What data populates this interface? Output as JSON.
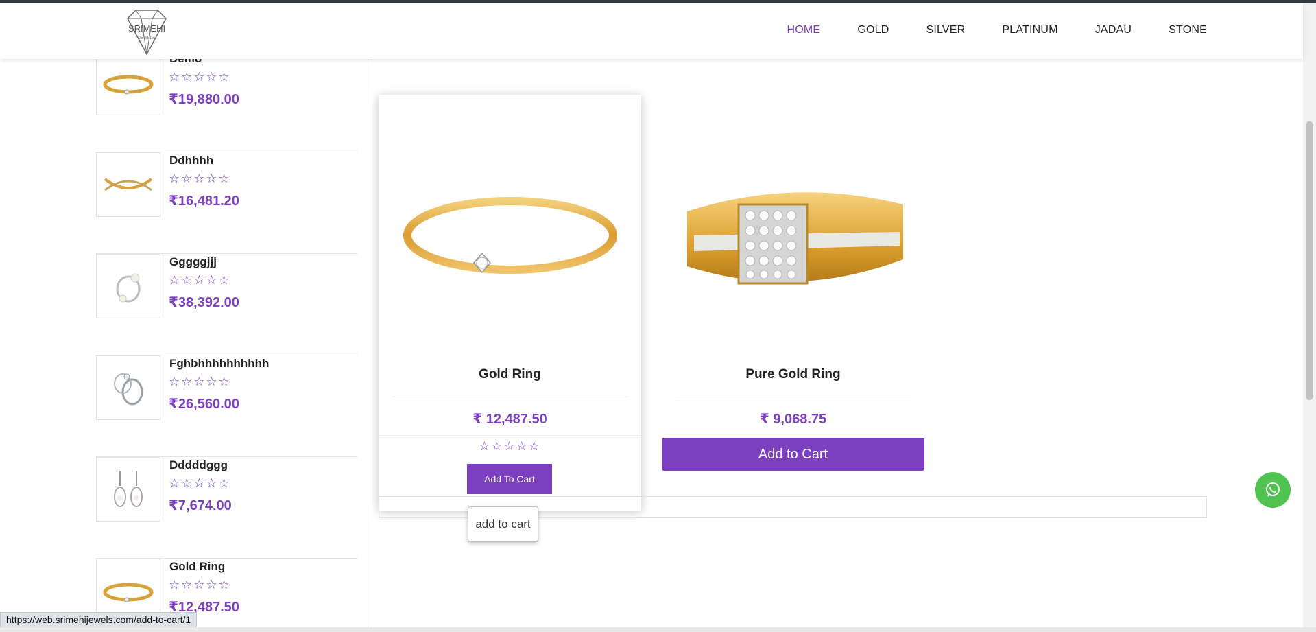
{
  "brand": {
    "logo_text": "SRIMEHI",
    "logo_sub": "JEWELS"
  },
  "nav": [
    {
      "label": "HOME",
      "active": true
    },
    {
      "label": "GOLD",
      "active": false
    },
    {
      "label": "SILVER",
      "active": false
    },
    {
      "label": "PLATINUM",
      "active": false
    },
    {
      "label": "JADAU",
      "active": false
    },
    {
      "label": "STONE",
      "active": false
    }
  ],
  "sidebar": {
    "items": [
      {
        "name": "Demo",
        "stars": "☆☆☆☆☆",
        "price": "19,880.00",
        "thumb": "gold-ring-icon"
      },
      {
        "name": "Ddhhhh",
        "stars": "☆☆☆☆☆",
        "price": "16,481.20",
        "thumb": "cross-ring-icon"
      },
      {
        "name": "Gggggjjj",
        "stars": "☆☆☆☆☆",
        "price": "38,392.00",
        "thumb": "pearl-ring-icon"
      },
      {
        "name": "Fghbhhhhhhhhhh",
        "stars": "☆☆☆☆☆",
        "price": "26,560.00",
        "thumb": "silver-ring-icon"
      },
      {
        "name": "Dddddggg",
        "stars": "☆☆☆☆☆",
        "price": "7,674.00",
        "thumb": "earrings-icon"
      },
      {
        "name": "Gold Ring",
        "stars": "☆☆☆☆☆",
        "price": "12,487.50",
        "thumb": "gold-ring-icon"
      }
    ]
  },
  "currency_symbol": "₹",
  "products": [
    {
      "title": "Gold Ring",
      "price": "12,487.50",
      "stars": "☆☆☆☆☆",
      "button": "Add To Cart"
    },
    {
      "title": "Pure Gold Ring",
      "price": "9,068.75",
      "button": "Add to Cart"
    }
  ],
  "tooltip": "add to cart",
  "status_url": "https://web.srimehijewels.com/add-to-cart/1",
  "colors": {
    "accent": "#7b3fbf",
    "whatsapp": "#4fc24f"
  }
}
